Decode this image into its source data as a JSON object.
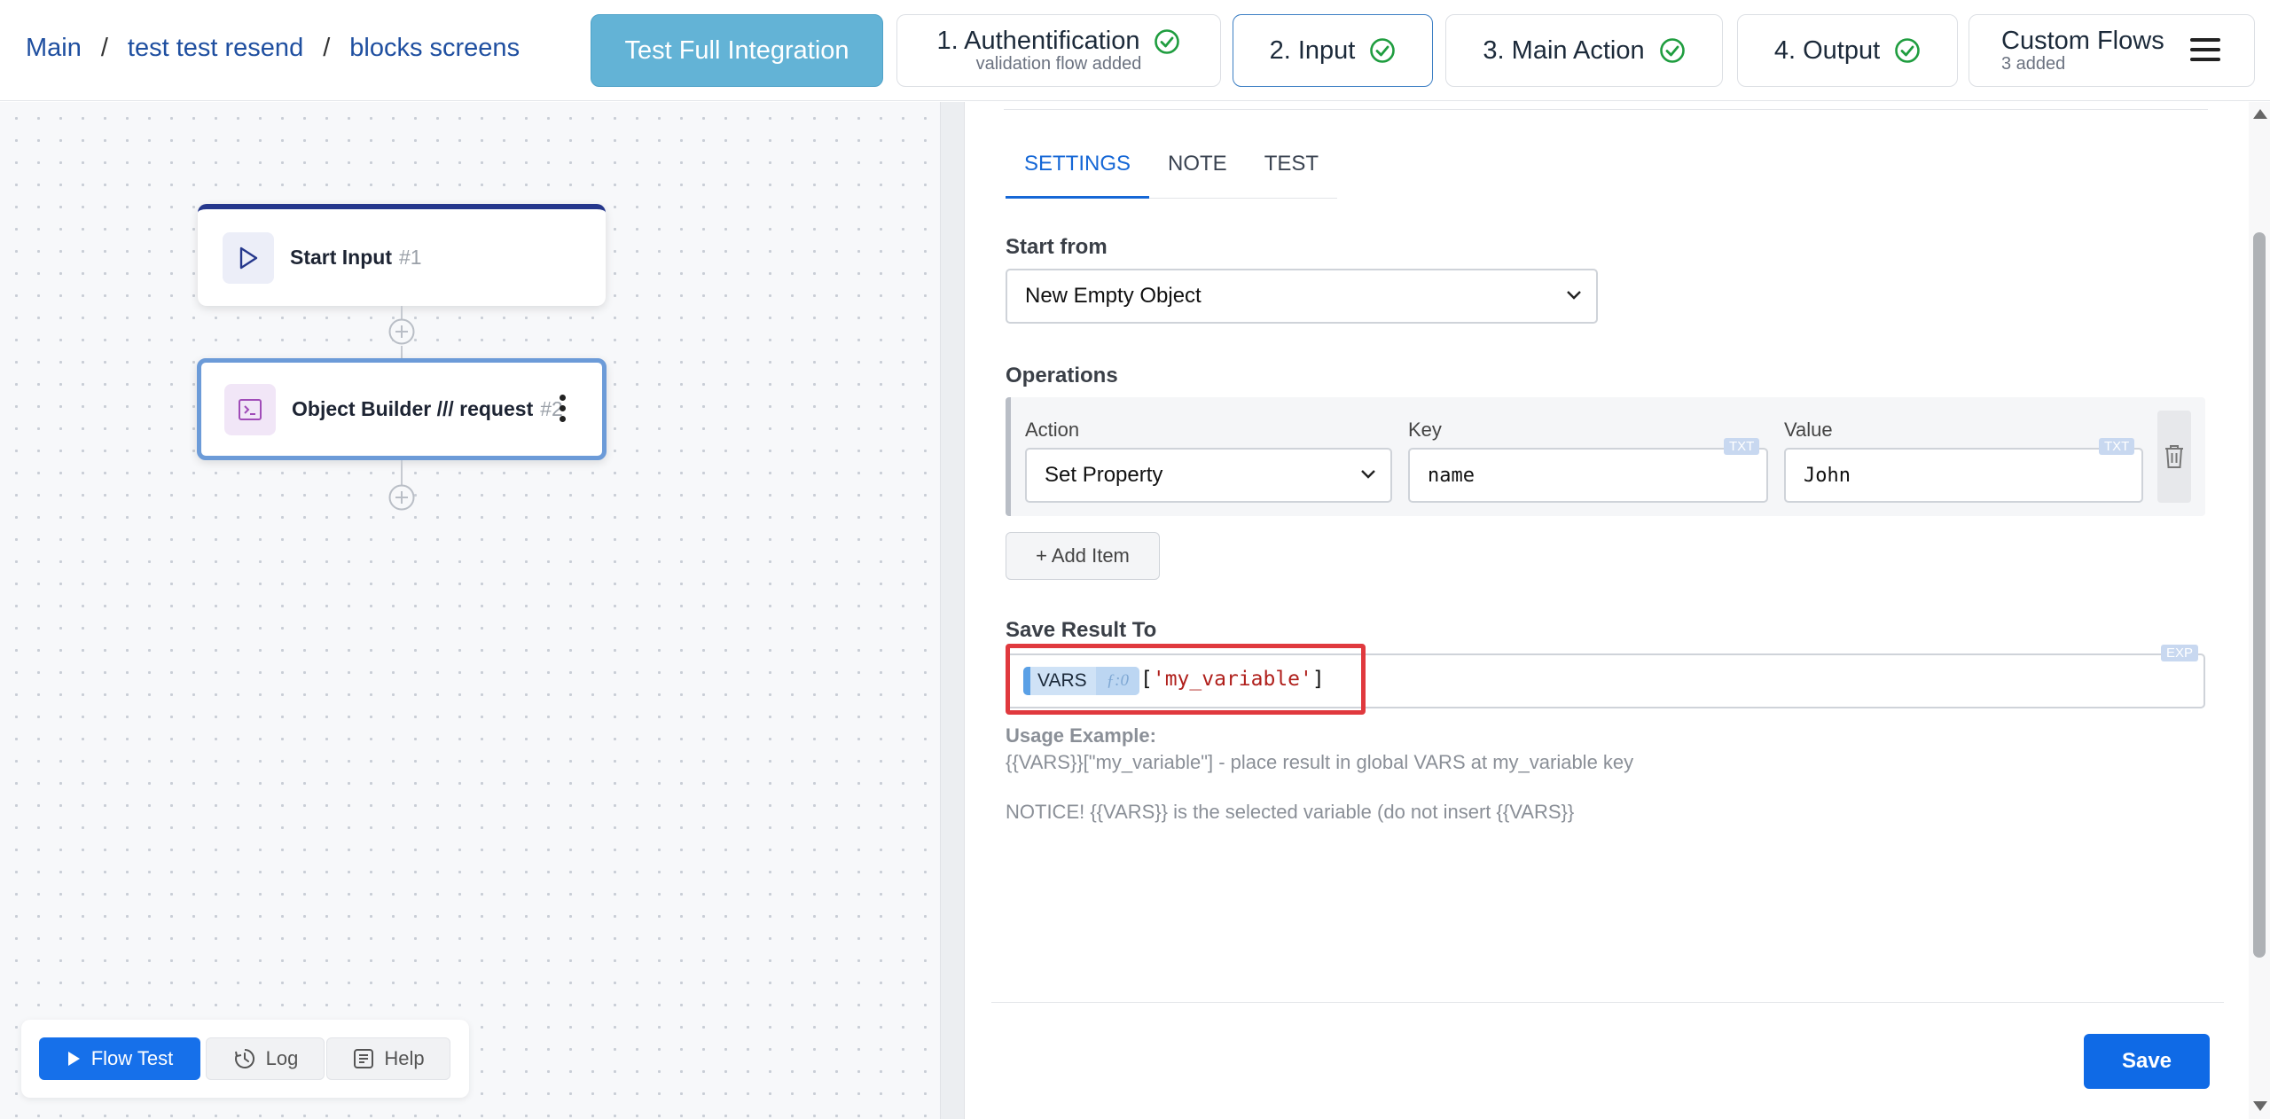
{
  "breadcrumb": {
    "items": [
      "Main",
      "test test resend",
      "blocks screens"
    ],
    "separator": "/"
  },
  "steps": {
    "full_integration": "Test Full Integration",
    "auth": {
      "label": "1. Authentification",
      "sub": "validation flow added",
      "status": "check-icon"
    },
    "input": {
      "label": "2. Input",
      "status": "check-icon"
    },
    "main_action": {
      "label": "3. Main Action",
      "status": "check-icon"
    },
    "output": {
      "label": "4. Output",
      "status": "check-icon"
    },
    "custom_flows": {
      "label": "Custom Flows",
      "sub": "3 added"
    }
  },
  "nodes": [
    {
      "title": "Start Input",
      "num": "#1",
      "icon": "play-icon"
    },
    {
      "title": "Object Builder /// request",
      "num": "#2",
      "icon": "terminal-icon"
    }
  ],
  "toolbar": {
    "flow_test": "Flow Test",
    "log": "Log",
    "help": "Help"
  },
  "panel": {
    "tabs": [
      "SETTINGS",
      "NOTE",
      "TEST"
    ],
    "active_tab": "SETTINGS",
    "start_from": {
      "label": "Start from",
      "value": "New Empty Object"
    },
    "operations": {
      "label": "Operations",
      "headers": {
        "action": "Action",
        "key": "Key",
        "value": "Value"
      },
      "rows": [
        {
          "action": "Set Property",
          "key": "name",
          "value": "John",
          "key_badge": "TXT",
          "value_badge": "TXT"
        }
      ],
      "add_item": "+ Add Item"
    },
    "save_result": {
      "label": "Save Result To",
      "badge": "EXP",
      "var_name": "VARS",
      "var_index": "ƒ:0",
      "expr_open": "[",
      "expr_key": "'my_variable'",
      "expr_close": "]"
    },
    "help": {
      "title": "Usage Example:",
      "line1": "{{VARS}}[\"my_variable\"] - place result in global VARS at my_variable key",
      "line2": "NOTICE! {{VARS}} is the selected variable (do not insert {{VARS}}"
    },
    "save_button": "Save"
  },
  "colors": {
    "accent": "#1670ea",
    "full_integration_bg": "#63b3d6",
    "check": "#1f9d3f",
    "highlight": "#e0393e",
    "start_node_border": "#25378c",
    "selected_node_border": "#6c9bd8"
  }
}
